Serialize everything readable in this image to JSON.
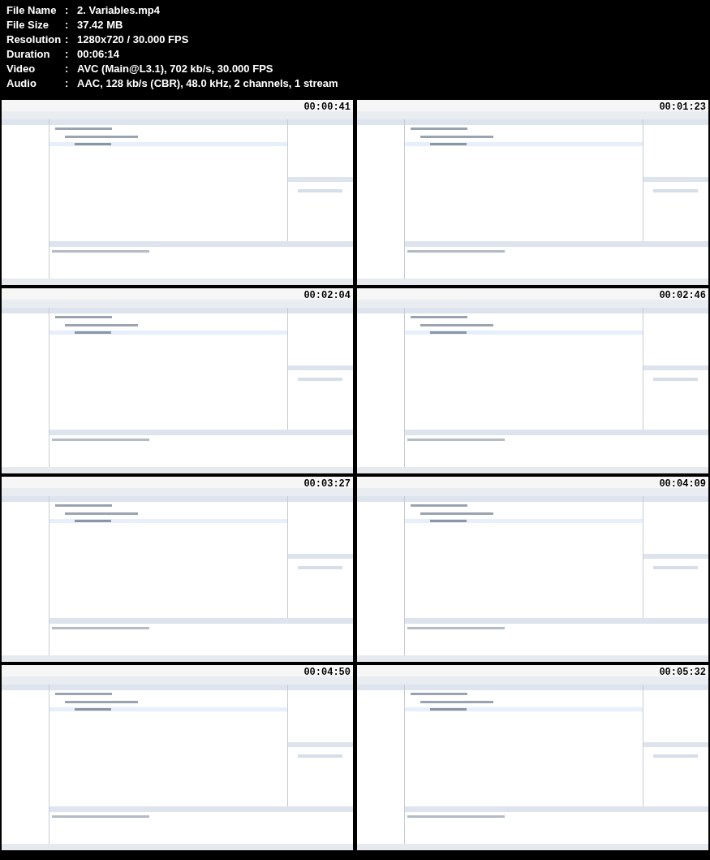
{
  "media_info": [
    {
      "label": "File Name",
      "separator": ":",
      "value": "2. Variables.mp4"
    },
    {
      "label": "File Size",
      "separator": ":",
      "value": "37.42 MB"
    },
    {
      "label": "Resolution",
      "separator": ":",
      "value": "1280x720 / 30.000 FPS"
    },
    {
      "label": "Duration",
      "separator": ":",
      "value": "00:06:14"
    },
    {
      "label": "Video",
      "separator": ":",
      "value": "AVC (Main@L3.1), 702 kb/s, 30.000 FPS"
    },
    {
      "label": "Audio",
      "separator": ":",
      "value": "AAC, 128 kb/s (CBR), 48.0 kHz, 2 channels, 1 stream"
    }
  ],
  "frames": [
    {
      "kind": "picture",
      "timestamp": "00:00:41"
    },
    {
      "kind": "picture",
      "timestamp": "00:01:23"
    },
    {
      "kind": "picture",
      "timestamp": "00:02:04"
    },
    {
      "kind": "picture",
      "timestamp": "00:02:46"
    },
    {
      "kind": "picture",
      "timestamp": "00:03:27"
    },
    {
      "kind": "picture",
      "timestamp": "00:04:09"
    },
    {
      "kind": "picture",
      "timestamp": "00:04:50"
    },
    {
      "kind": "picture",
      "timestamp": "00:05:32"
    }
  ]
}
